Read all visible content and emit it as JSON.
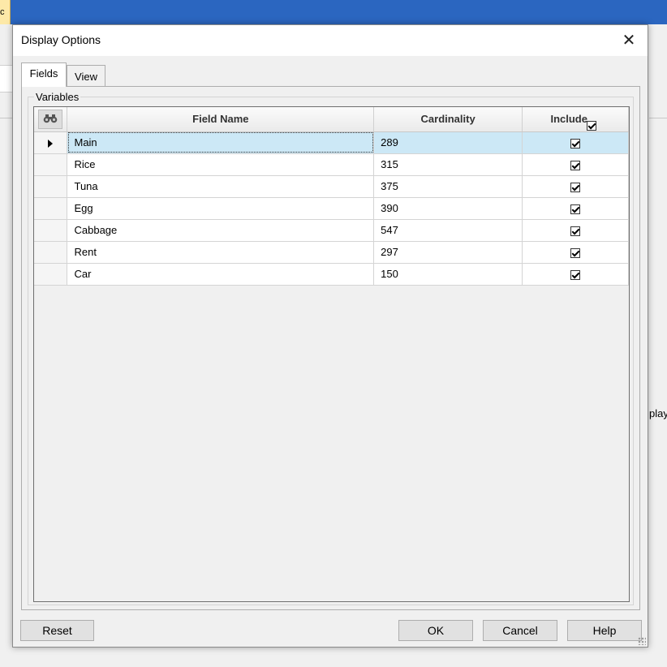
{
  "background": {
    "left_tab_text": "c",
    "right_text": "play"
  },
  "dialog": {
    "title": "Display Options",
    "close_glyph": "✕",
    "tabs": [
      {
        "label": "Fields",
        "active": true
      },
      {
        "label": "View",
        "active": false
      }
    ],
    "group_label": "Variables",
    "grid": {
      "columns": [
        "Field Name",
        "Cardinality",
        "Include"
      ],
      "header_include_checked": true,
      "header_icon": "binoculars-icon",
      "rows": [
        {
          "field": "Main",
          "cardinality": "289",
          "include": true,
          "selected": true
        },
        {
          "field": "Rice",
          "cardinality": "315",
          "include": true,
          "selected": false
        },
        {
          "field": "Tuna",
          "cardinality": "375",
          "include": true,
          "selected": false
        },
        {
          "field": "Egg",
          "cardinality": "390",
          "include": true,
          "selected": false
        },
        {
          "field": "Cabbage",
          "cardinality": "547",
          "include": true,
          "selected": false
        },
        {
          "field": "Rent",
          "cardinality": "297",
          "include": true,
          "selected": false
        },
        {
          "field": "Car",
          "cardinality": "150",
          "include": true,
          "selected": false
        }
      ]
    },
    "buttons": {
      "reset": "Reset",
      "ok": "OK",
      "cancel": "Cancel",
      "help": "Help"
    }
  },
  "colors": {
    "titlebar": "#2b66c0",
    "selected_row": "#cce8f6"
  }
}
